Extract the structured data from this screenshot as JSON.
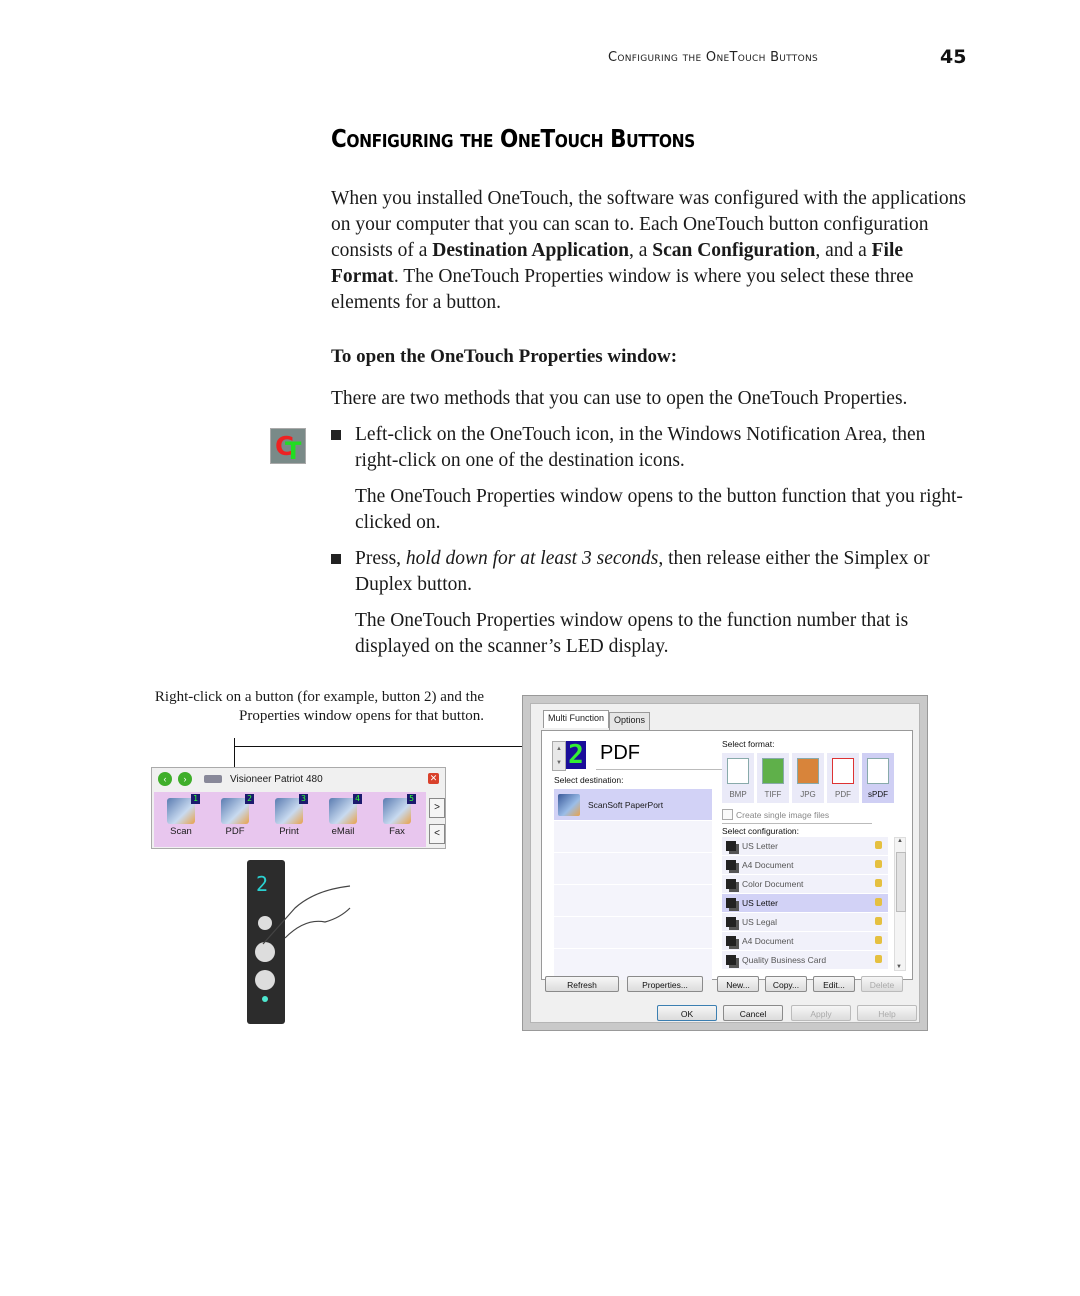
{
  "header": {
    "running_title": "Configuring the OneTouch Buttons",
    "page_number": "45"
  },
  "title": "Configuring the OneTouch Buttons",
  "intro": "When you installed OneTouch, the software was configured with the applications on your computer that you can scan to. Each OneTouch button configuration consists of a Destination Application, a Scan Configuration, and a File Format. The OneTouch Properties window is where you select these three elements for a button.",
  "subheading": "To open the OneTouch Properties window:",
  "methods_intro": "There are two methods that you can use to open the OneTouch Properties.",
  "bullets": [
    {
      "text": "Left-click on the OneTouch icon, in the Windows Notification Area, then right-click on one of the destination icons.",
      "follow": "The OneTouch Properties window opens to the button function that you right-clicked on."
    },
    {
      "text": "Press, hold down for at least 3 seconds, then release either the Simplex or Duplex button.",
      "follow": "The OneTouch Properties window opens to the function number that is displayed on the scanner’s LED display."
    }
  ],
  "caption": "Right-click on a button (for example, button 2) and the Properties window opens for that button.",
  "properties_window": {
    "tabs": [
      "Multi Function",
      "Options"
    ],
    "button_number": "2",
    "format_name": "PDF",
    "select_destination_label": "Select destination:",
    "destinations": [
      "ScanSoft PaperPort"
    ],
    "select_format_label": "Select format:",
    "formats": [
      "BMP",
      "TIFF",
      "JPG",
      "PDF",
      "sPDF"
    ],
    "selected_format": "sPDF",
    "create_single_label": "Create single image files",
    "select_configuration_label": "Select configuration:",
    "configurations": [
      "US Letter",
      "A4 Document",
      "Color Document",
      "US Letter",
      "US Legal",
      "A4 Document",
      "Quality Business Card"
    ],
    "selected_configuration_index": 3,
    "buttons": {
      "refresh": "Refresh",
      "properties": "Properties...",
      "new": "New...",
      "copy": "Copy...",
      "edit": "Edit...",
      "delete": "Delete",
      "ok": "OK",
      "cancel": "Cancel",
      "apply": "Apply",
      "help": "Help"
    }
  },
  "onetouch_panel": {
    "title": "Visioneer Patriot 480",
    "buttons": [
      {
        "label": "Scan",
        "num": "1"
      },
      {
        "label": "PDF",
        "num": "2"
      },
      {
        "label": "Print",
        "num": "3"
      },
      {
        "label": "eMail",
        "num": "4"
      },
      {
        "label": "Fax",
        "num": "5"
      }
    ],
    "next": ">",
    "prev": "<"
  },
  "scanner": {
    "led": "2"
  }
}
